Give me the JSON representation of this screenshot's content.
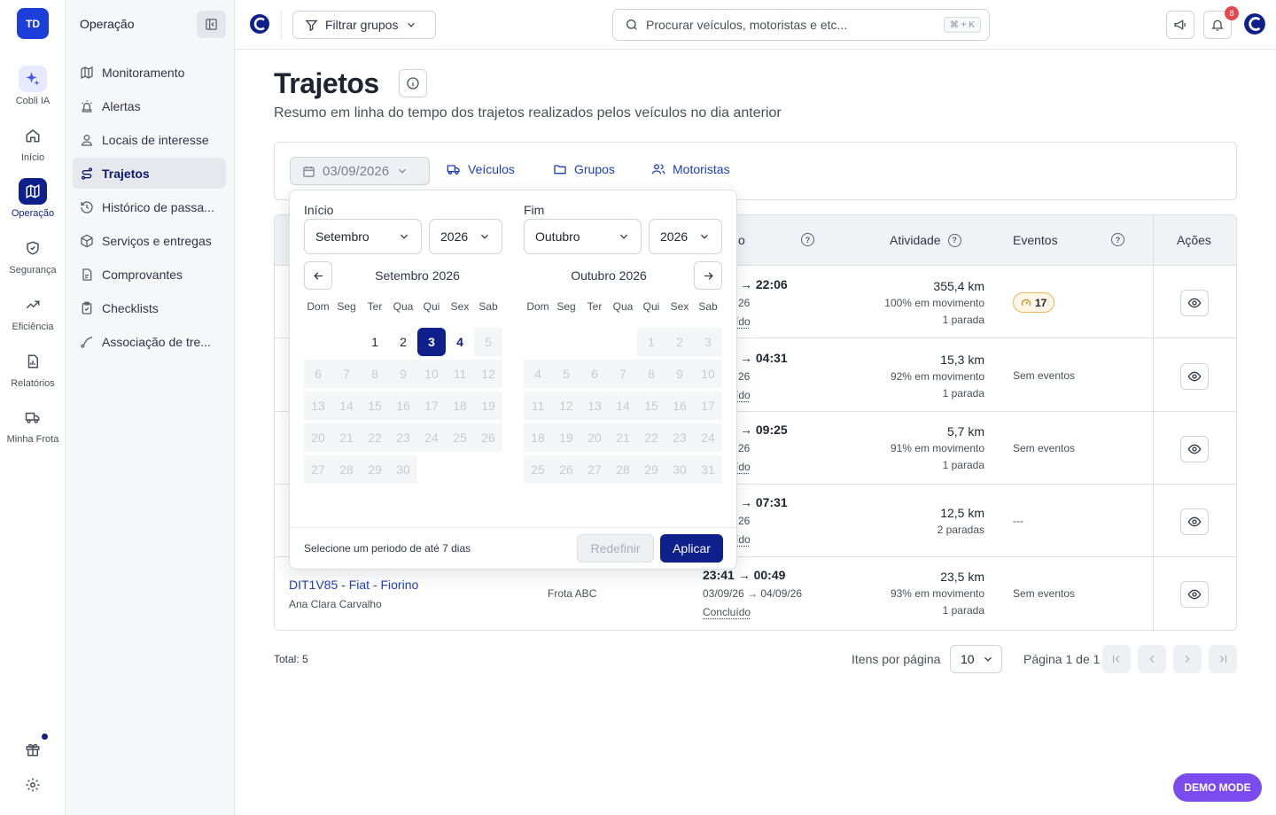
{
  "rail": {
    "avatar": "TD",
    "items": [
      {
        "label": "Cobli IA",
        "icon": "sparkle-icon"
      },
      {
        "label": "Início",
        "icon": "home-icon"
      },
      {
        "label": "Operação",
        "icon": "map-icon"
      },
      {
        "label": "Segurança",
        "icon": "shield-icon"
      },
      {
        "label": "Eficiência",
        "icon": "trend-icon"
      },
      {
        "label": "Relatórios",
        "icon": "report-icon"
      },
      {
        "label": "Minha Frota",
        "icon": "truck-icon"
      }
    ]
  },
  "subnav": {
    "title": "Operação",
    "items": [
      {
        "label": "Monitoramento",
        "icon": "map-icon"
      },
      {
        "label": "Alertas",
        "icon": "siren-icon"
      },
      {
        "label": "Locais de interesse",
        "icon": "pin-user-icon"
      },
      {
        "label": "Trajetos",
        "icon": "route-icon"
      },
      {
        "label": "Histórico de passa...",
        "icon": "history-icon"
      },
      {
        "label": "Serviços e entregas",
        "icon": "box-icon"
      },
      {
        "label": "Comprovantes",
        "icon": "file-icon"
      },
      {
        "label": "Checklists",
        "icon": "clipboard-icon"
      },
      {
        "label": "Associação de tre...",
        "icon": "link-icon"
      }
    ]
  },
  "topbar": {
    "filter_label": "Filtrar grupos",
    "search_placeholder": "Procurar veículos, motoristas e etc...",
    "search_shortcut": "⌘ + K",
    "notifications_count": "8"
  },
  "page": {
    "title": "Trajetos",
    "subtitle": "Resumo em linha do tempo dos trajetos realizados pelos veículos no dia anterior",
    "date": "03/09/2026",
    "tabs": [
      "Veículos",
      "Grupos",
      "Motoristas"
    ]
  },
  "table": {
    "headers": {
      "period_suffix": "o",
      "activity": "Atividade",
      "events": "Eventos",
      "actions": "Ações"
    },
    "rows": [
      {
        "time": "→ 22:06",
        "dates": "26",
        "status": "ído",
        "km": "355,4 km",
        "movement": "100% em movimento",
        "stops": "1 parada",
        "events": "17",
        "events_badge": true
      },
      {
        "time": "→ 04:31",
        "dates": "26",
        "status": "ído",
        "km": "15,3 km",
        "movement": "92% em movimento",
        "stops": "1 parada",
        "events": "Sem eventos"
      },
      {
        "time": "→ 09:25",
        "dates": "26",
        "status": "ído",
        "km": "5,7 km",
        "movement": "91% em movimento",
        "stops": "1 parada",
        "events": "Sem eventos"
      },
      {
        "time": "→ 07:31",
        "dates": "26",
        "status": "ído",
        "km": "12,5 km",
        "movement": "",
        "stops": "2 paradas",
        "events": "---"
      },
      {
        "vehicle": "DIT1V85 - Fiat - Fiorino",
        "driver": "Ana Clara Carvalho",
        "group": "Frota ABC",
        "time": "23:41 → 00:49",
        "dates": "03/09/26 → 04/09/26",
        "status": "Concluído",
        "km": "23,5 km",
        "movement": "93% em movimento",
        "stops": "1 parada",
        "events": "Sem eventos"
      }
    ]
  },
  "footer": {
    "total": "Total: 5",
    "items_per_page_label": "Itens por página",
    "items_per_page": "10",
    "page_text": "Página 1 de 1"
  },
  "picker": {
    "start_label": "Início",
    "end_label": "Fim",
    "start_month": "Setembro",
    "start_year": "2026",
    "end_month": "Outubro",
    "end_year": "2026",
    "left_title": "Setembro 2026",
    "right_title": "Outubro 2026",
    "weekdays": [
      "Dom",
      "Seg",
      "Ter",
      "Qua",
      "Qui",
      "Sex",
      "Sab"
    ],
    "hint": "Selecione um periodo de até 7 dias",
    "reset": "Redefinir",
    "apply": "Aplicar",
    "left_month": {
      "first_weekday": 2,
      "days": 30,
      "enabled": [
        1,
        2,
        3,
        4
      ],
      "selected": 3,
      "highlighted": 4
    },
    "right_month": {
      "first_weekday": 4,
      "days": 31,
      "enabled": [],
      "selected": null,
      "highlighted": null
    }
  },
  "demo_mode": "DEMO MODE"
}
